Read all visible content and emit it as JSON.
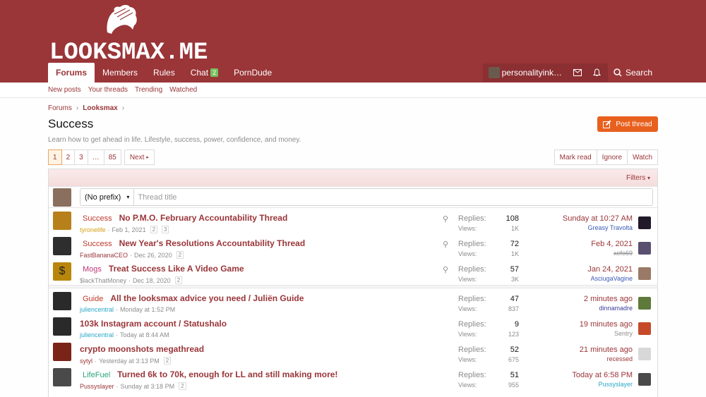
{
  "logo": {
    "text": "LOOKSMAX.ME"
  },
  "nav": {
    "tabs": [
      {
        "label": "Forums",
        "active": true
      },
      {
        "label": "Members"
      },
      {
        "label": "Rules"
      },
      {
        "label": "Chat",
        "badge": "2"
      },
      {
        "label": "PornDude"
      }
    ]
  },
  "user": {
    "name": "personalityink…",
    "search_label": "Search"
  },
  "subnav": [
    "New posts",
    "Your threads",
    "Trending",
    "Watched"
  ],
  "breadcrumb": {
    "root": "Forums",
    "current": "Looksmax"
  },
  "page": {
    "title": "Success",
    "description": "Learn how to get ahead in life. Lifestyle, success, power, confidence, and money.",
    "post_thread_label": "Post thread"
  },
  "pager": {
    "pages": [
      "1",
      "2",
      "3",
      "…",
      "85"
    ],
    "next_label": "Next"
  },
  "actions": [
    "Mark read",
    "Ignore",
    "Watch"
  ],
  "filters_label": "Filters",
  "new_thread": {
    "prefix": "(No prefix)",
    "placeholder": "Thread title"
  },
  "labels": {
    "replies": "Replies:",
    "views": "Views:"
  },
  "threads": [
    {
      "prefix": "Success",
      "prefix_color": "#c0392b",
      "title": "No P.M.O. February Accountability Thread",
      "author": "tyronelife",
      "author_color": "#d4a017",
      "date": "Feb 1, 2021",
      "pages": [
        "2",
        "3"
      ],
      "sticky": true,
      "replies": "108",
      "views": "1K",
      "last_date": "Sunday at 10:27 AM",
      "last_user": "Greasy Travolta",
      "last_user_color": "#3b5ab8",
      "avatar_color": "#b8801a",
      "last_avatar_color": "#221a2a"
    },
    {
      "prefix": "Success",
      "prefix_color": "#c0392b",
      "title": "New Year's Resolutions Accountability Thread",
      "author": "FastBananaCEO",
      "author_color": "#9a3538",
      "date": "Dec 26, 2020",
      "pages": [
        "2"
      ],
      "sticky": true,
      "replies": "72",
      "views": "1K",
      "last_date": "Feb 4, 2021",
      "last_user": "xefo69",
      "last_user_color": "#8c8c8c",
      "last_user_strike": true,
      "avatar_color": "#2e2e2e",
      "last_avatar_color": "#5b4f70"
    },
    {
      "prefix": "Mogs",
      "prefix_color": "#c0367a",
      "title": "Treat Success Like A Video Game",
      "author": "$lackThatMoney",
      "author_color": "#8c8c8c",
      "date": "Dec 18, 2020",
      "pages": [
        "2"
      ],
      "sticky": true,
      "replies": "57",
      "views": "3K",
      "last_date": "Jan 24, 2021",
      "last_user": "AsciugaVagine",
      "last_user_color": "#3b5ab8",
      "avatar_color": "#b8860b",
      "avatar_glyph": "$",
      "last_avatar_color": "#9a7a66"
    },
    {
      "prefix": "Guide",
      "prefix_color": "#c0392b",
      "title": "All the looksmax advice you need / Juliën Guide",
      "author": "juliencentral",
      "author_color": "#2aa7c9",
      "date": "Monday at 1:52 PM",
      "pages": [],
      "sticky": false,
      "replies": "47",
      "views": "837",
      "last_date": "2 minutes ago",
      "last_user": "dinnamadre",
      "last_user_color": "#3b3b9a",
      "avatar_color": "#2a2a2a",
      "last_avatar_color": "#5e7a3a"
    },
    {
      "prefix": "",
      "prefix_color": "",
      "title": "103k Instagram account / Statushalo",
      "author": "juliencentral",
      "author_color": "#2aa7c9",
      "date": "Today at 8:44 AM",
      "pages": [],
      "sticky": false,
      "replies": "9",
      "views": "123",
      "last_date": "19 minutes ago",
      "last_user": "Sentry",
      "last_user_color": "#8c8c8c",
      "avatar_color": "#2a2a2a",
      "last_avatar_color": "#c64a2a"
    },
    {
      "prefix": "",
      "prefix_color": "",
      "title": "crypto moonshots megathread",
      "author": "sytyl",
      "author_color": "#9a3538",
      "date": "Yesterday at 3:13 PM",
      "pages": [
        "2"
      ],
      "sticky": false,
      "replies": "52",
      "views": "675",
      "last_date": "21 minutes ago",
      "last_user": "recessed",
      "last_user_color": "#9a3538",
      "avatar_color": "#7a2418",
      "last_avatar_color": "#d8d8d8"
    },
    {
      "prefix": "LifeFuel",
      "prefix_color": "#2aa17b",
      "title": "Turned 6k to 70k, enough for LL and still making more!",
      "author": "Pussyslayer",
      "author_color": "#9a3538",
      "date": "Sunday at 3:18 PM",
      "pages": [
        "2"
      ],
      "sticky": false,
      "replies": "51",
      "views": "955",
      "last_date": "Today at 6:58 PM",
      "last_user": "Pussyslayer",
      "last_user_color": "#2aa7c9",
      "avatar_color": "#4a4a4a",
      "last_avatar_color": "#4a4a4a"
    }
  ]
}
